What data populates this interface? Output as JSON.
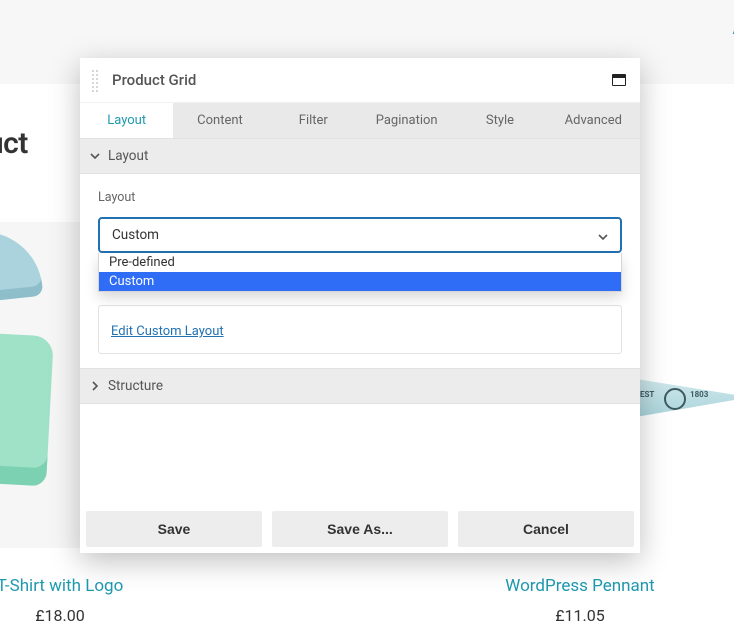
{
  "background": {
    "heading_fragment": "oduct",
    "top_right_char": "A",
    "products": [
      {
        "title": "T-Shirt with Logo",
        "price": "£18.00"
      },
      {
        "title": "WordPress Pennant",
        "price": "£11.05",
        "pennant_left": "EST",
        "pennant_right": "1803"
      }
    ]
  },
  "modal": {
    "title": "Product Grid",
    "tabs": [
      "Layout",
      "Content",
      "Filter",
      "Pagination",
      "Style",
      "Advanced"
    ],
    "active_tab_index": 0,
    "sections": {
      "layout": {
        "label": "Layout",
        "field_label": "Layout",
        "selected": "Custom",
        "options": [
          "Pre-defined",
          "Custom"
        ],
        "highlight_index": 1,
        "edit_link": "Edit Custom Layout"
      },
      "structure": {
        "label": "Structure"
      }
    },
    "buttons": {
      "save": "Save",
      "save_as": "Save As...",
      "cancel": "Cancel"
    }
  }
}
